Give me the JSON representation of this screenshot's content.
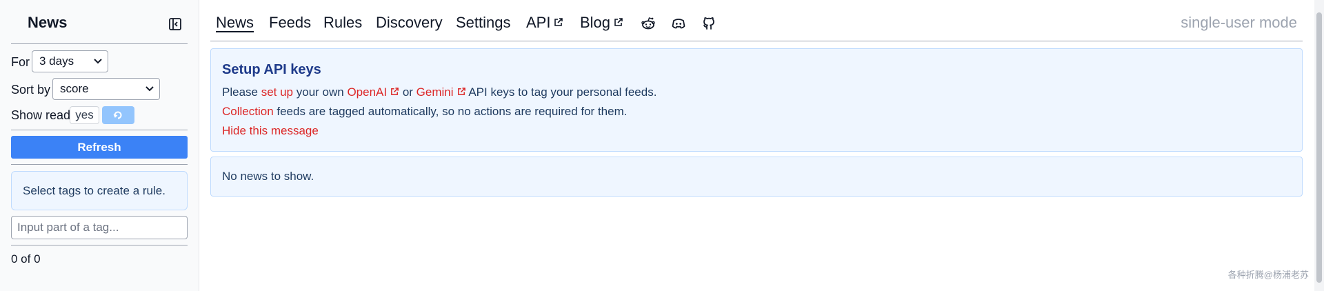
{
  "sidebar": {
    "title": "News",
    "for_label": "For",
    "for_value": "3 days",
    "sort_label": "Sort by",
    "sort_value": "score",
    "show_read_label": "Show read",
    "show_read_value": "yes",
    "refresh_label": "Refresh",
    "rule_hint": "Select tags to create a rule.",
    "tag_input_placeholder": "Input part of a tag...",
    "count": "0 of 0"
  },
  "nav": {
    "items": [
      {
        "label": "News"
      },
      {
        "label": "Feeds"
      },
      {
        "label": "Rules"
      },
      {
        "label": "Discovery"
      },
      {
        "label": "Settings"
      },
      {
        "label": "API"
      },
      {
        "label": "Blog"
      }
    ],
    "icons": [
      "reddit-icon",
      "discord-icon",
      "github-icon"
    ],
    "mode": "single-user mode"
  },
  "setup": {
    "title": "Setup API keys",
    "l1_a": "Please ",
    "l1_setup": "set up",
    "l1_b": " your own ",
    "l1_openai": "OpenAI",
    "l1_c": " or ",
    "l1_gemini": "Gemini",
    "l1_d": " API keys to tag your personal feeds.",
    "l2_collection": "Collection",
    "l2_rest": " feeds are tagged automatically, so no actions are required for them.",
    "l3_hide": "Hide this message"
  },
  "news": {
    "empty": "No news to show."
  },
  "watermark": "各种折腾@杨浦老苏",
  "colors": {
    "accent": "#3b82f6",
    "link": "#dc2626",
    "panel_bg": "#eff6ff",
    "panel_border": "#bfdbfe",
    "muted": "#9ca3af"
  }
}
